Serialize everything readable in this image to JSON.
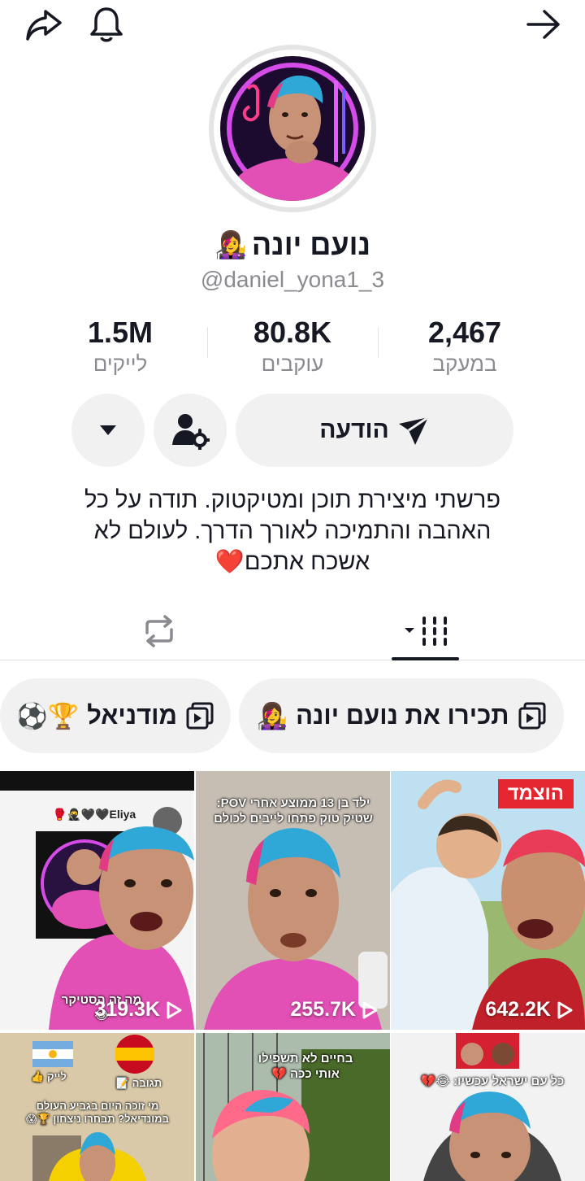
{
  "header": {
    "share_icon": "share-arrow-icon",
    "bell_icon": "bell-icon",
    "forward_icon": "arrow-right-icon"
  },
  "profile": {
    "name": "נועם יונה",
    "name_emoji": "👩‍🎤",
    "handle": "@daniel_yona1_3"
  },
  "stats": [
    {
      "value": "1.5M",
      "label": "לייקים"
    },
    {
      "value": "80.8K",
      "label": "עוקבים"
    },
    {
      "value": "2,467",
      "label": "במעקב"
    }
  ],
  "actions": {
    "message_label": "הודעה"
  },
  "bio": {
    "lines": [
      "פרשתי מיצירת תוכן ומטיקטוק. תודה על כל",
      "האהבה והתמיכה לאורך הדרך. לעולם לא",
      "אשכח אתכם❤️"
    ]
  },
  "playlists": [
    {
      "label": "תכירו את נועם יונה",
      "emoji": "👩‍🎤"
    },
    {
      "label": "מודניאל",
      "emoji": "🏆⚽"
    }
  ],
  "videos": [
    {
      "views": "319.3K",
      "caption": "מה זה הסטיקר 😂",
      "top_text": "Eliya🖤🖤🥷🥊"
    },
    {
      "views": "255.7K",
      "caption": "ילד בן 13 ממוצע אחרי POV: שטיק טוק פתחו לייבים לכולם"
    },
    {
      "views": "642.2K",
      "tag": "הוצמד"
    },
    {
      "views": "",
      "caption": "מי זוכה היום בגביע העולם במונדיאל? תבחרו ניצחון 🏆😱",
      "chip_left": "לייק 👍",
      "chip_right": "תגובה 📝"
    },
    {
      "views": "",
      "caption": "בחיים לא תשפילו אותי ככה 💔"
    },
    {
      "views": "",
      "caption": "כל עם ישראל עכשיו: 😂💔"
    }
  ],
  "colors": {
    "accent_red": "#e3262f",
    "secondary_text": "#8a8b91",
    "button_bg": "#f1f1f2"
  }
}
